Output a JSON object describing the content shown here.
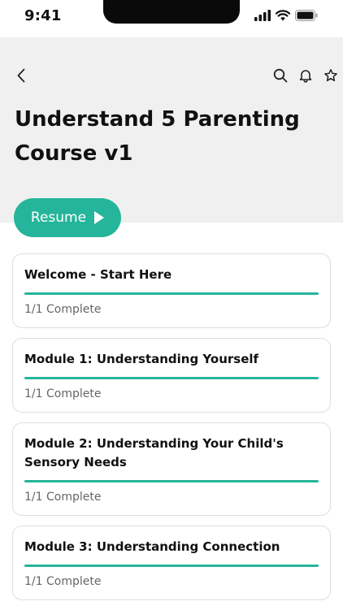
{
  "status_bar": {
    "time": "9:41"
  },
  "header": {
    "title": "Understand 5 Parenting Course v1",
    "icons": [
      "chevron-left-icon",
      "search-icon",
      "bell-icon",
      "star-icon"
    ]
  },
  "resume": {
    "label": "Resume"
  },
  "colors": {
    "accent": "#25b59a",
    "header_bg": "#f0f0f0",
    "card_border": "#dedede",
    "muted_text": "#666666"
  },
  "modules": [
    {
      "title": "Welcome - Start Here",
      "status": "1/1 Complete",
      "progress": 1.0
    },
    {
      "title": "Module 1: Understanding Yourself",
      "status": "1/1 Complete",
      "progress": 1.0
    },
    {
      "title": "Module 2: Understanding Your Child's Sensory Needs",
      "status": "1/1 Complete",
      "progress": 1.0
    },
    {
      "title": "Module 3: Understanding Connection",
      "status": "1/1 Complete",
      "progress": 1.0
    }
  ]
}
